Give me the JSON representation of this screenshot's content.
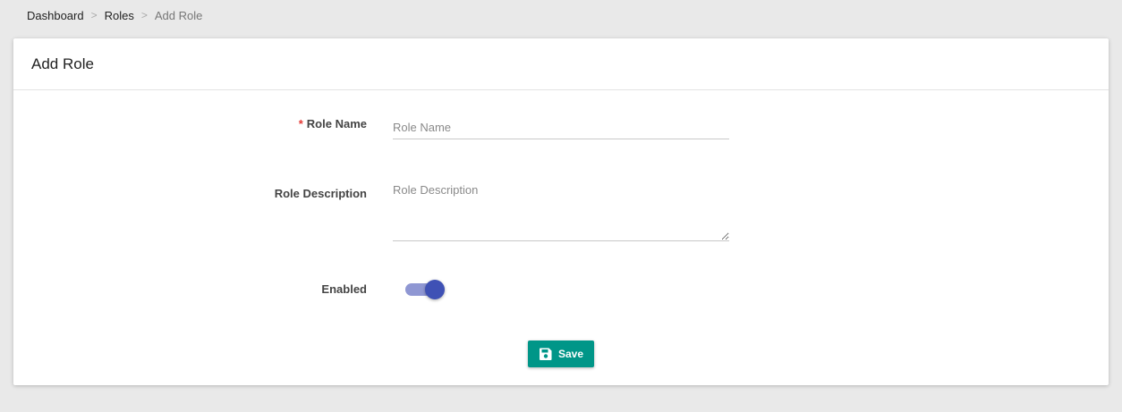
{
  "breadcrumb": {
    "items": [
      "Dashboard",
      "Roles"
    ],
    "current": "Add Role",
    "separator": ">"
  },
  "card": {
    "title": "Add Role"
  },
  "form": {
    "role_name": {
      "label": "Role Name",
      "required_marker": "*",
      "placeholder": "Role Name",
      "value": ""
    },
    "role_description": {
      "label": "Role Description",
      "placeholder": "Role Description",
      "value": ""
    },
    "enabled": {
      "label": "Enabled",
      "value": true
    }
  },
  "actions": {
    "save_label": "Save",
    "save_icon": "floppy-disk-icon"
  },
  "colors": {
    "background": "#e9e9e9",
    "primary_button": "#009688",
    "toggle_on": "#3f51b5",
    "toggle_track_on": "#8f97d3",
    "required": "#e53935"
  }
}
